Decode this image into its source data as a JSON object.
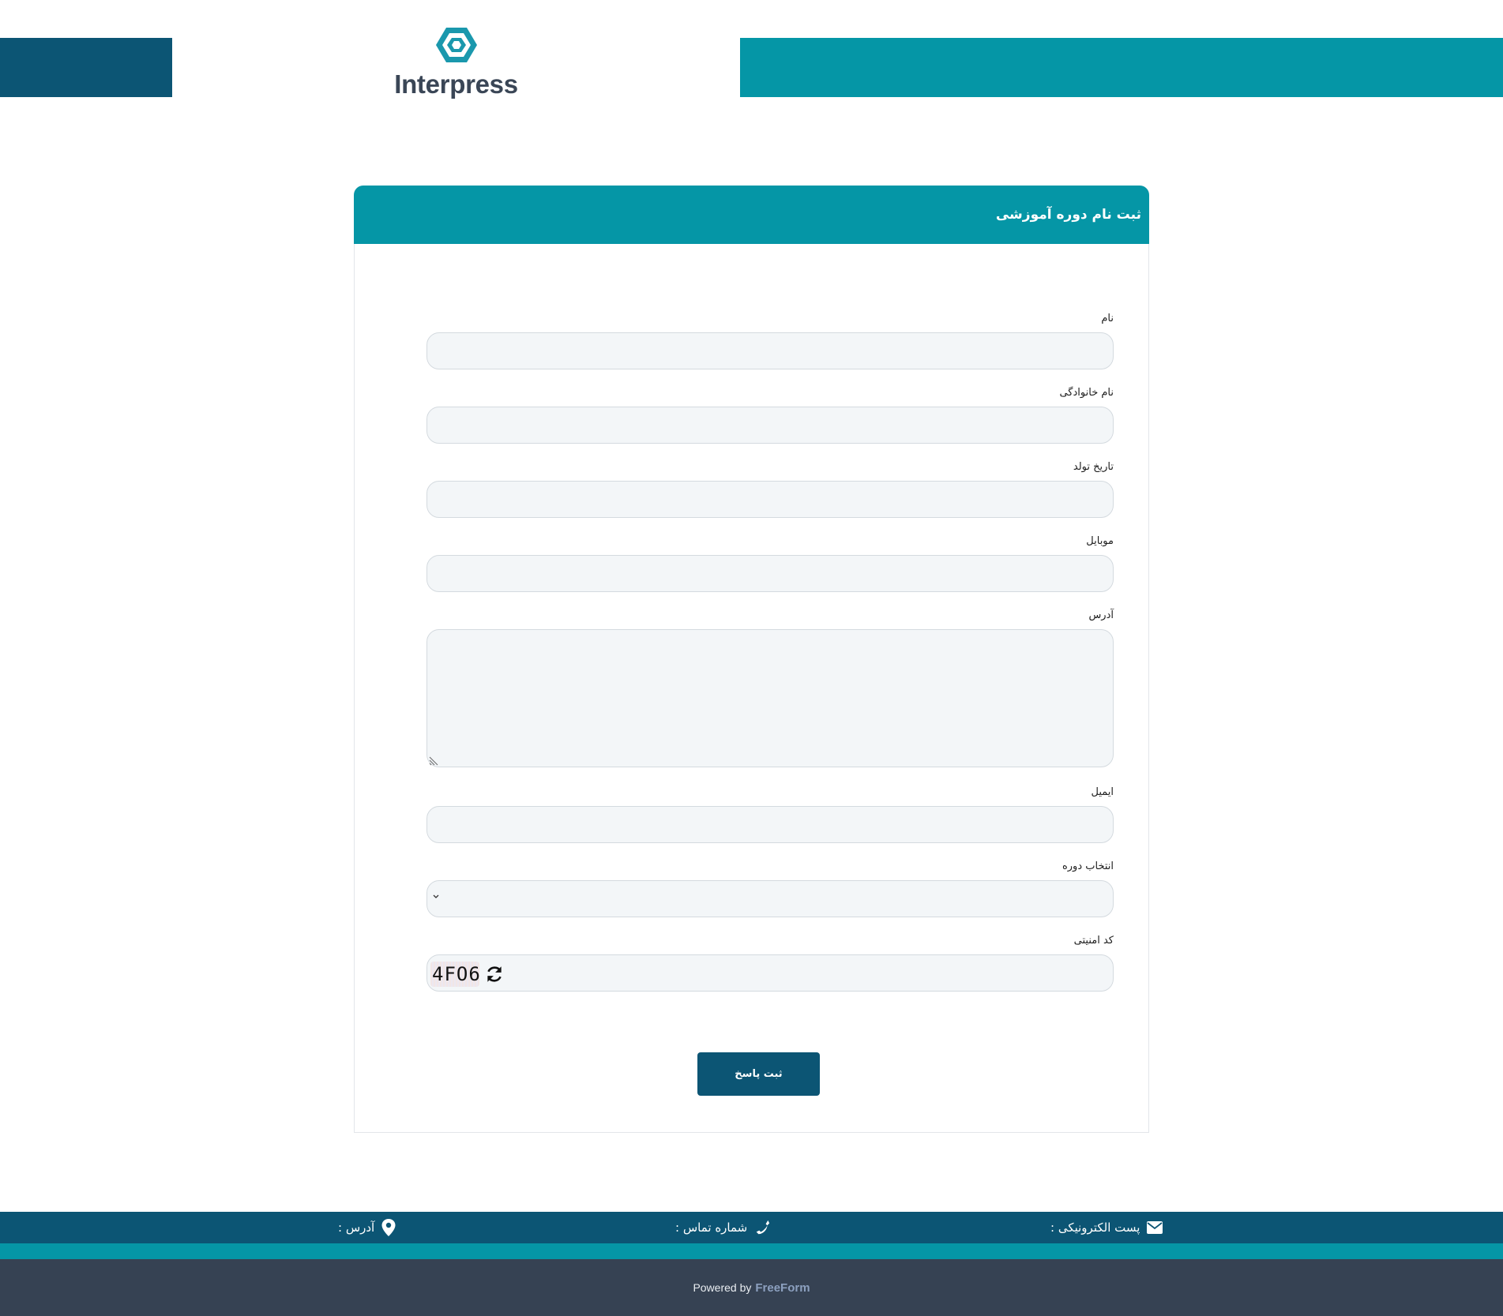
{
  "brand": {
    "name": "Interpress"
  },
  "form": {
    "title": "ثبت نام دوره آموزشی",
    "fields": [
      {
        "label": "نام",
        "value": ""
      },
      {
        "label": "نام خانوادگی",
        "value": ""
      },
      {
        "label": "تاریخ تولد",
        "value": ""
      },
      {
        "label": "موبایل",
        "value": ""
      },
      {
        "label": "آدرس",
        "value": ""
      },
      {
        "label": "ایمیل",
        "value": ""
      },
      {
        "label": "انتخاب دوره",
        "value": ""
      },
      {
        "label": "کد امنیتی",
        "captcha": "4FO6"
      }
    ],
    "submit_label": "ثبت پاسخ"
  },
  "footer": {
    "email_label": "پست الکترونیکی :",
    "phone_label": "شماره تماس :",
    "address_label": "آدرس :",
    "powered_by": "Powered by",
    "powered_brand": "FreeForm"
  },
  "icons": {
    "logo": "hexagon-logo-icon",
    "email": "envelope-icon",
    "phone": "phone-icon",
    "address": "location-pin-icon",
    "refresh": "refresh-icon",
    "select": "chevron-down-icon"
  },
  "colors": {
    "primary_dark": "#0c5574",
    "primary_teal": "#0596a6",
    "footer_dark": "#364253"
  }
}
